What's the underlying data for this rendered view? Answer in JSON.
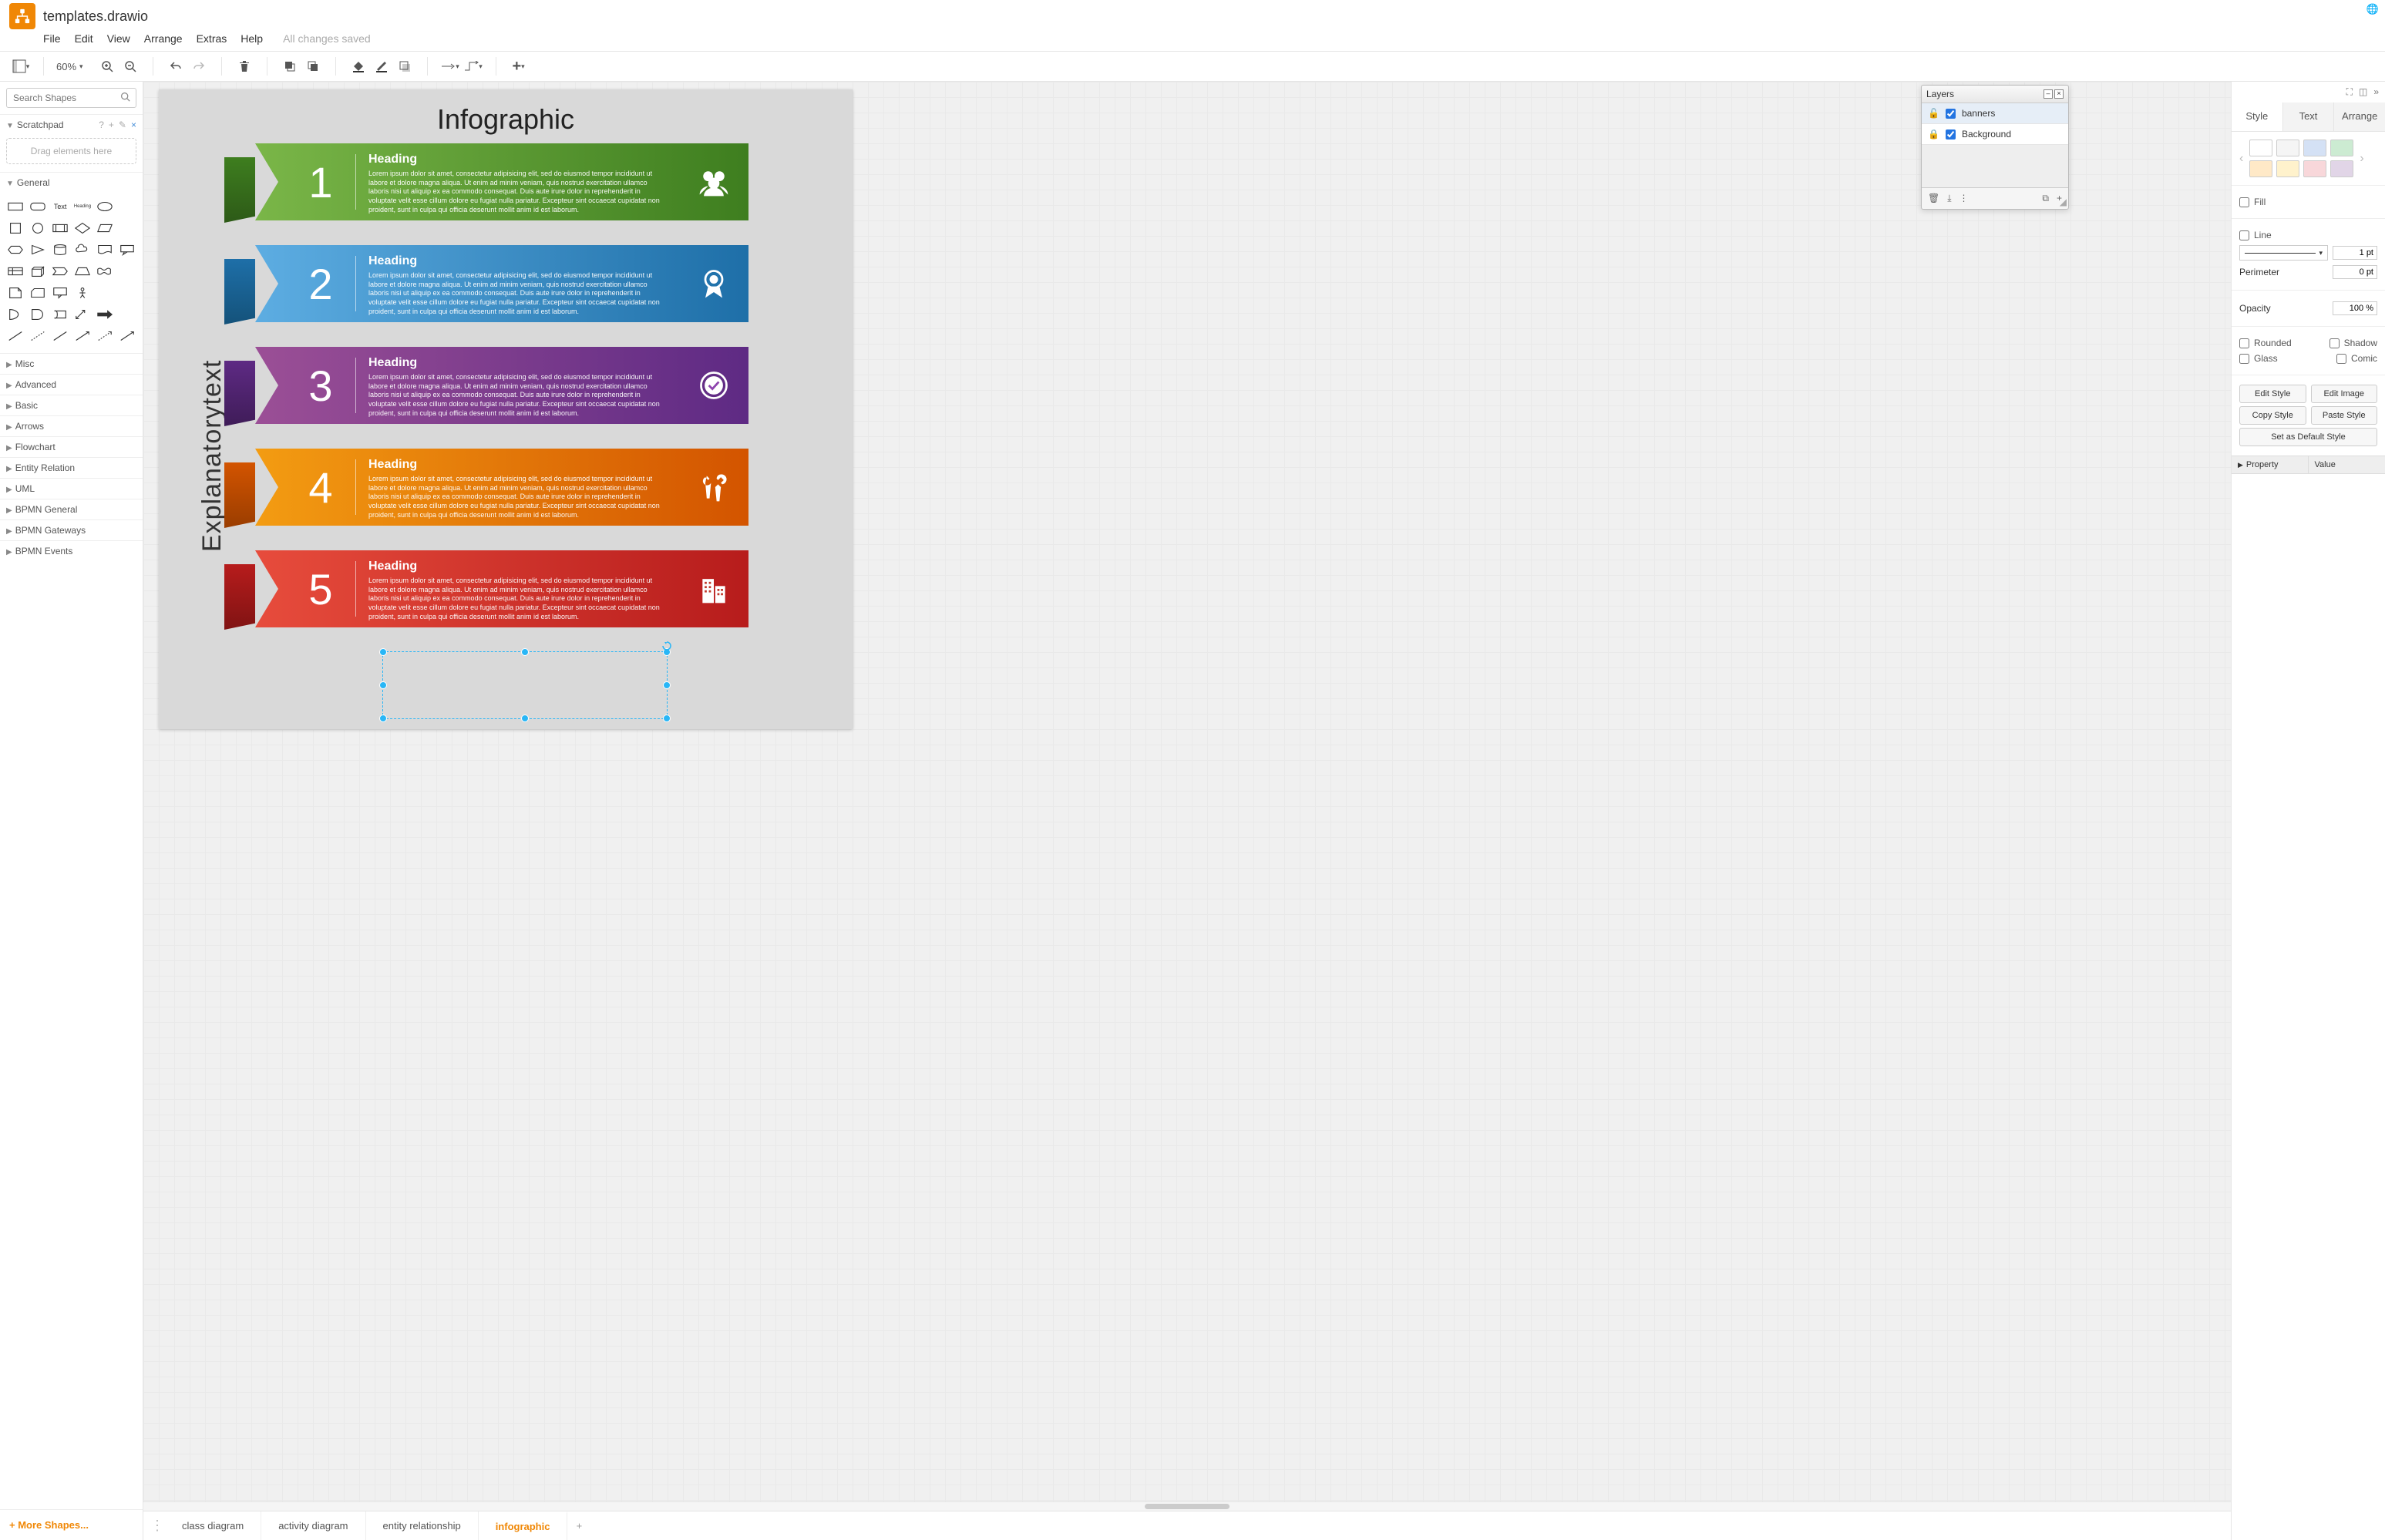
{
  "app": {
    "filename": "templates.drawio",
    "save_status": "All changes saved"
  },
  "menu": {
    "file": "File",
    "edit": "Edit",
    "view": "View",
    "arrange": "Arrange",
    "extras": "Extras",
    "help": "Help"
  },
  "toolbar": {
    "zoom": "60%"
  },
  "left": {
    "search_placeholder": "Search Shapes",
    "scratchpad": "Scratchpad",
    "scratch_hint": "Drag elements here",
    "general": "General",
    "text_label": "Text",
    "heading_label": "Heading",
    "categories": [
      "Misc",
      "Advanced",
      "Basic",
      "Arrows",
      "Flowchart",
      "Entity Relation",
      "UML",
      "BPMN General",
      "BPMN Gateways",
      "BPMN Events"
    ],
    "more": "+ More Shapes..."
  },
  "canvas": {
    "title": "Infographic",
    "side_label": "Explanatorytext",
    "lorem": "Lorem ipsum dolor sit amet, consectetur adipisicing elit, sed do eiusmod tempor incididunt ut labore et dolore magna aliqua. Ut enim ad minim veniam, quis nostrud exercitation ullamco laboris nisi ut aliquip ex ea commodo consequat. Duis aute irure dolor in reprehenderit in voluptate velit esse cillum dolore eu fugiat nulla pariatur. Excepteur sint occaecat cupidatat non proident, sunt in culpa qui officia deserunt mollit anim id est laborum.",
    "banners": [
      {
        "num": "1",
        "heading": "Heading",
        "color": "green",
        "icon": "users-icon"
      },
      {
        "num": "2",
        "heading": "Heading",
        "color": "blue",
        "icon": "award-icon"
      },
      {
        "num": "3",
        "heading": "Heading",
        "color": "purple",
        "icon": "check-badge-icon"
      },
      {
        "num": "4",
        "heading": "Heading",
        "color": "orange",
        "icon": "tools-icon"
      },
      {
        "num": "5",
        "heading": "Heading",
        "color": "red",
        "icon": "buildings-icon"
      }
    ]
  },
  "tabs": {
    "items": [
      "class diagram",
      "activity diagram",
      "entity relationship",
      "infographic"
    ],
    "active": 3
  },
  "layers": {
    "title": "Layers",
    "items": [
      {
        "name": "banners",
        "locked": false,
        "visible": true,
        "active": true
      },
      {
        "name": "Background",
        "locked": true,
        "visible": true,
        "active": false
      }
    ]
  },
  "right": {
    "tabs": {
      "style": "Style",
      "text": "Text",
      "arrange": "Arrange"
    },
    "swatches_row1": [
      "#ffffff",
      "#f5f5f5",
      "#d4e1f5",
      "#ccebd2"
    ],
    "swatches_row2": [
      "#ffe9c7",
      "#fff2cc",
      "#f8d7da",
      "#e1d5e7"
    ],
    "fill": "Fill",
    "line": "Line",
    "line_pt": "1 pt",
    "perimeter": "Perimeter",
    "perimeter_pt": "0 pt",
    "opacity": "Opacity",
    "opacity_val": "100 %",
    "rounded": "Rounded",
    "shadow": "Shadow",
    "glass": "Glass",
    "comic": "Comic",
    "edit_style": "Edit Style",
    "edit_image": "Edit Image",
    "copy_style": "Copy Style",
    "paste_style": "Paste Style",
    "set_default": "Set as Default Style",
    "property": "Property",
    "value": "Value"
  }
}
